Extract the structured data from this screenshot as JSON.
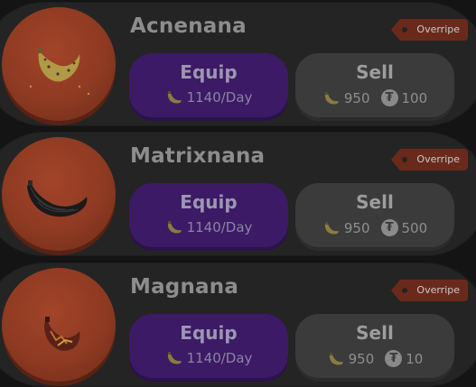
{
  "items": [
    {
      "name": "Acnenana",
      "badge": "Overripe",
      "equip_label": "Equip",
      "rate": "1140/Day",
      "sell_label": "Sell",
      "sell_bananas": "950",
      "sell_tokens": "100",
      "art_icon": "acne-banana-icon"
    },
    {
      "name": "Matrixnana",
      "badge": "Overripe",
      "equip_label": "Equip",
      "rate": "1140/Day",
      "sell_label": "Sell",
      "sell_bananas": "950",
      "sell_tokens": "500",
      "art_icon": "matrix-banana-icon"
    },
    {
      "name": "Magnana",
      "badge": "Overripe",
      "equip_label": "Equip",
      "rate": "1140/Day",
      "sell_label": "Sell",
      "sell_bananas": "950",
      "sell_tokens": "10",
      "art_icon": "magma-banana-icon"
    }
  ],
  "icons": {
    "currency": "banana-icon",
    "token": "tether-token-icon"
  },
  "colors": {
    "equip": "#3c1a66",
    "sell": "#3b3b3b",
    "badge": "#6a2a1b",
    "avatar": "#8e3a22"
  }
}
